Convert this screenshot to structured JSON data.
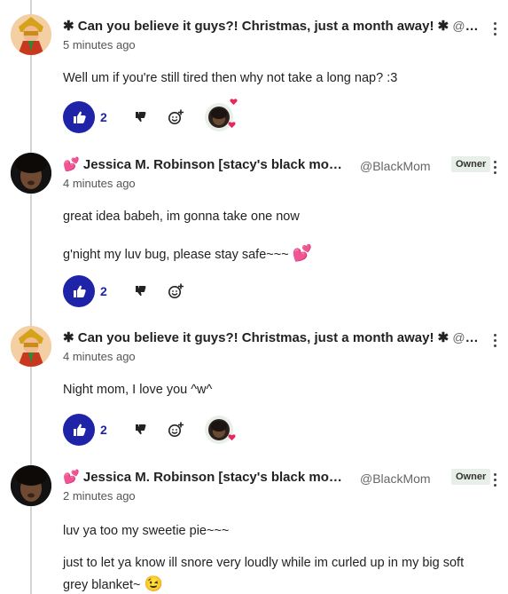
{
  "comments": [
    {
      "author": "✱ Can you believe it guys?! Christmas, just a month away! ✱",
      "handle": "@Re...",
      "time": "5 minutes ago",
      "lines": [
        "Well um if you're still tired then why not take a long nap? :3"
      ],
      "likes": "2",
      "has_reaction": true
    },
    {
      "author": "Jessica M. Robinson [stacy's black mom]",
      "handle": "@BlackMom",
      "badge": "Owner",
      "time": "4 minutes ago",
      "lines": [
        "great idea babeh, im gonna take one now",
        "g'night my luv bug, please stay safe~~~"
      ],
      "likes": "2",
      "has_reaction": false
    },
    {
      "author": "✱ Can you believe it guys?! Christmas, just a month away! ✱",
      "handle": "@Re...",
      "time": "4 minutes ago",
      "lines": [
        "Night mom, I love you ^w^"
      ],
      "likes": "2",
      "has_reaction": true
    },
    {
      "author": "Jessica M. Robinson [stacy's black mom]",
      "handle": "@BlackMom",
      "badge": "Owner",
      "time": "2 minutes ago",
      "lines": [
        "luv ya too my sweetie pie~~~",
        "just to let ya know ill snore very loudly while im curled up in my big soft",
        "grey blanket~"
      ]
    }
  ],
  "icons": {
    "like": "thumbs-up-icon",
    "dislike": "thumbs-down-icon",
    "react": "add-reaction-icon",
    "menu": "more-vertical-icon",
    "heart_emoji": "two-hearts-emoji",
    "wink_emoji": "winking-face-emoji"
  },
  "colors": {
    "like_button": "#1e23a8",
    "owner_badge_bg": "#e8efe8",
    "thread_line": "#d4d4d4"
  }
}
